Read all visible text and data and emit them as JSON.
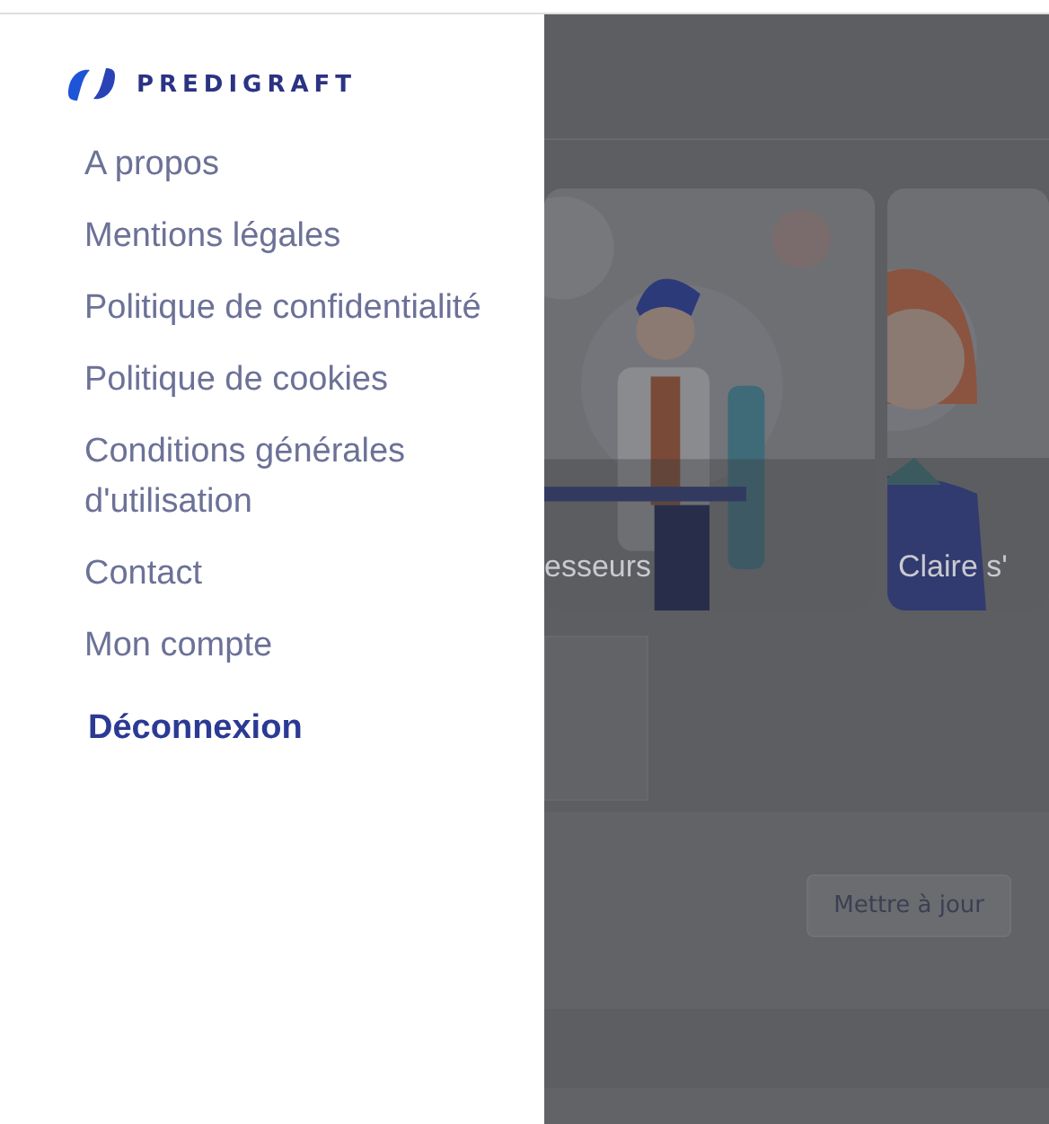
{
  "drawer": {
    "logo": "PREDIGRAFT",
    "items": [
      {
        "label": "A propos",
        "kind": "link"
      },
      {
        "label": "Mentions légales",
        "kind": "link"
      },
      {
        "label": "Politique de confidentialité",
        "kind": "link"
      },
      {
        "label": "Politique de cookies",
        "kind": "link"
      },
      {
        "label": "Conditions générales d'utilisation",
        "kind": "link"
      },
      {
        "label": "Contact",
        "kind": "link"
      },
      {
        "label": "Mon compte",
        "kind": "link"
      },
      {
        "label": "Déconnexion",
        "kind": "logout"
      }
    ]
  },
  "background": {
    "cards": [
      {
        "caption": "esseurs",
        "kind": "picture"
      },
      {
        "caption": "Claire s'",
        "kind": "picture"
      }
    ],
    "update_button": "Mettre à jour"
  }
}
